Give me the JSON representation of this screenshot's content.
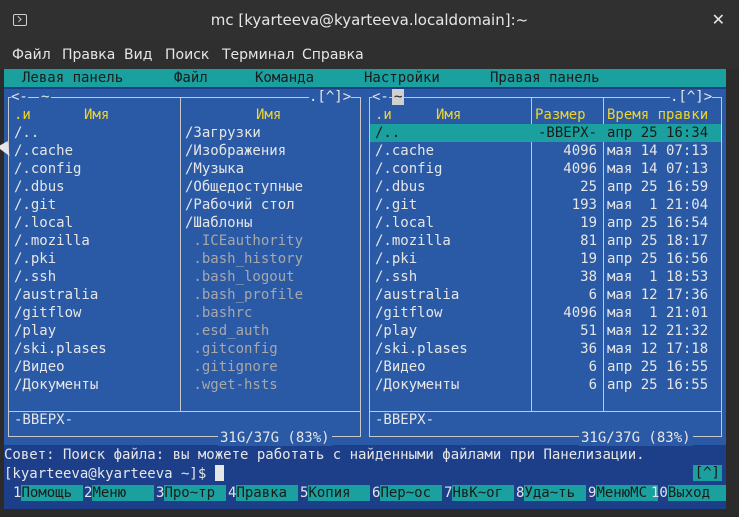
{
  "window": {
    "title": "mc [kyarteeva@kyarteeva.localdomain]:~",
    "close_glyph": "✕"
  },
  "menubar": {
    "items": [
      "Файл",
      "Правка",
      "Вид",
      "Поиск",
      "Терминал",
      "Справка"
    ]
  },
  "mc_menu": {
    "items": [
      "Левая панель",
      "Файл",
      "Команда",
      "Настройки",
      "Правая панель"
    ]
  },
  "left_panel": {
    "title": "~",
    "corner": ".[^]>",
    "left_corner": "<-",
    "headers": {
      "n": ".и",
      "name1": "Имя",
      "name2": "Имя"
    },
    "col1": [
      "/..",
      "/.cache",
      "/.config",
      "/.dbus",
      "/.git",
      "/.local",
      "/.mozilla",
      "/.pki",
      "/.ssh",
      "/australia",
      "/gitflow",
      "/play",
      "/ski.plases",
      "/Видео",
      "/Документы"
    ],
    "col2": [
      "/Загрузки",
      "/Изображения",
      "/Музыка",
      "/Общедоступные",
      "/Рабочий стол",
      "/Шаблоны",
      " .ICEauthority",
      " .bash_history",
      " .bash_logout",
      " .bash_profile",
      " .bashrc",
      " .esd_auth",
      " .gitconfig",
      " .gitignore",
      " .wget-hsts"
    ],
    "info": "-ВВЕРХ-",
    "stats": "31G/37G (83%)"
  },
  "right_panel": {
    "title": "~",
    "corner": ".[^]>",
    "left_corner": "<-",
    "headers": {
      "n": ".и",
      "name": "Имя",
      "size": "Размер",
      "time": "Время правки"
    },
    "rows": [
      {
        "name": "/..",
        "size": "-ВВЕРХ-",
        "time": "апр 25 16:34"
      },
      {
        "name": "/.cache",
        "size": "4096",
        "time": "мая 14 07:13"
      },
      {
        "name": "/.config",
        "size": "4096",
        "time": "мая 14 07:13"
      },
      {
        "name": "/.dbus",
        "size": "25",
        "time": "апр 25 16:59"
      },
      {
        "name": "/.git",
        "size": "193",
        "time": "мая  1 21:04"
      },
      {
        "name": "/.local",
        "size": "19",
        "time": "апр 25 16:54"
      },
      {
        "name": "/.mozilla",
        "size": "81",
        "time": "апр 25 18:17"
      },
      {
        "name": "/.pki",
        "size": "19",
        "time": "апр 25 16:56"
      },
      {
        "name": "/.ssh",
        "size": "38",
        "time": "мая  1 18:53"
      },
      {
        "name": "/australia",
        "size": "6",
        "time": "мая 12 17:36"
      },
      {
        "name": "/gitflow",
        "size": "4096",
        "time": "мая  1 21:01"
      },
      {
        "name": "/play",
        "size": "51",
        "time": "мая 12 21:32"
      },
      {
        "name": "/ski.plases",
        "size": "36",
        "time": "мая 12 17:18"
      },
      {
        "name": "/Видео",
        "size": "6",
        "time": "апр 25 16:55"
      },
      {
        "name": "/Документы",
        "size": "6",
        "time": "апр 25 16:55"
      }
    ],
    "info": "-ВВЕРХ-",
    "stats": "31G/37G (83%)"
  },
  "hint": "Совет: Поиск файла: вы можете работать с найденными файлами при Панелизации.",
  "prompt": "[kyarteeva@kyarteeva ~]$ ",
  "scroll_indicator": "[^]",
  "fkeys": [
    {
      "n": "1",
      "l": "Помощь"
    },
    {
      "n": "2",
      "l": "Меню"
    },
    {
      "n": "3",
      "l": "Про~тр"
    },
    {
      "n": "4",
      "l": "Правка"
    },
    {
      "n": "5",
      "l": "Копия"
    },
    {
      "n": "6",
      "l": "Пер~ос"
    },
    {
      "n": "7",
      "l": "НвК~ог"
    },
    {
      "n": "8",
      "l": "Уда~ть"
    },
    {
      "n": "9",
      "l": "МенюМС"
    },
    {
      "n": "10",
      "l": "Выход"
    }
  ]
}
